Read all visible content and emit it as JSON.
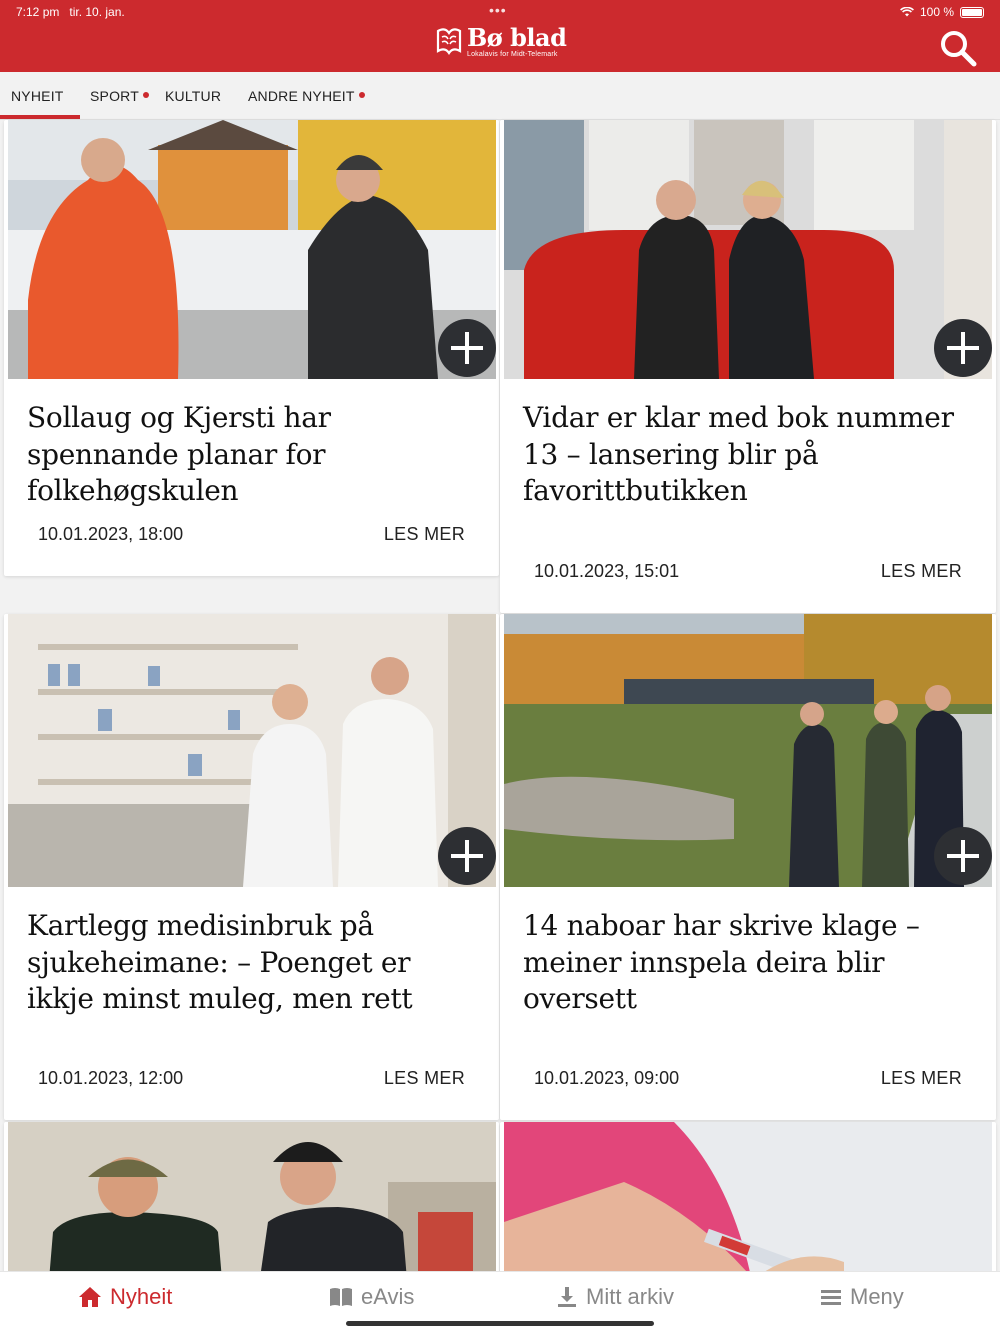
{
  "status": {
    "time": "7:12 pm",
    "date": "tir. 10. jan.",
    "battery": "100 %"
  },
  "brand": {
    "name": "Bø blad",
    "tagline": "Lokalavis for Midt-Telemark",
    "color": "#cc2a2e"
  },
  "tabs": [
    {
      "label": "NYHEIT",
      "active": true,
      "dot": false
    },
    {
      "label": "SPORT",
      "active": false,
      "dot": true
    },
    {
      "label": "KULTUR",
      "active": false,
      "dot": false
    },
    {
      "label": "ANDRE NYHEIT",
      "active": false,
      "dot": true
    }
  ],
  "articles": [
    {
      "title": "Sollaug og Kjersti har spennande planar for folkehøgskulen",
      "date": "10.01.2023, 18:00",
      "more": "LES MER"
    },
    {
      "title": "Vidar er klar med bok nummer 13 – lansering blir på favorittbutikken",
      "date": "10.01.2023, 15:01",
      "more": "LES MER"
    },
    {
      "title": "Kartlegg medisinbruk på sjukeheimane: – Poenget er ikkje minst muleg, men rett",
      "date": "10.01.2023, 12:00",
      "more": "LES MER"
    },
    {
      "title": "14 naboar har skrive klage – meiner innspela deira blir oversett",
      "date": "10.01.2023, 09:00",
      "more": "LES MER"
    }
  ],
  "bottom_nav": [
    {
      "label": "Nyheit",
      "icon": "home-icon",
      "active": true
    },
    {
      "label": "eAvis",
      "icon": "book-icon",
      "active": false
    },
    {
      "label": "Mitt arkiv",
      "icon": "download-icon",
      "active": false
    },
    {
      "label": "Meny",
      "icon": "menu-icon",
      "active": false
    }
  ]
}
